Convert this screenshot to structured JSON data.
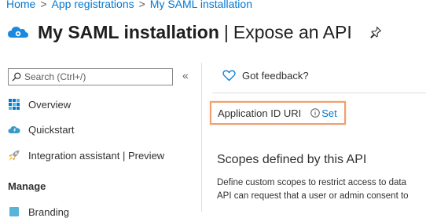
{
  "breadcrumb": {
    "items": [
      "Home",
      "App registrations",
      "My SAML installation"
    ],
    "separator": ">"
  },
  "header": {
    "title": "My SAML installation",
    "separator": "|",
    "subtitle": "Expose an API"
  },
  "sidebar": {
    "search_placeholder": "Search (Ctrl+/)",
    "collapse_glyph": "«",
    "items": [
      {
        "label": "Overview",
        "icon": "overview-grid-icon"
      },
      {
        "label": "Quickstart",
        "icon": "quickstart-cloud-icon"
      },
      {
        "label": "Integration assistant | Preview",
        "icon": "rocket-icon"
      }
    ],
    "section_label": "Manage",
    "partial_item": "Branding"
  },
  "main": {
    "feedback_label": "Got feedback?",
    "app_id_uri_label": "Application ID URI",
    "set_link": "Set",
    "scopes_title": "Scopes defined by this API",
    "scopes_desc_line1": "Define custom scopes to restrict access to data",
    "scopes_desc_line2": "API can request that a user or admin consent to"
  },
  "colors": {
    "accent": "#0078d4",
    "highlight_border": "#f0a070"
  }
}
